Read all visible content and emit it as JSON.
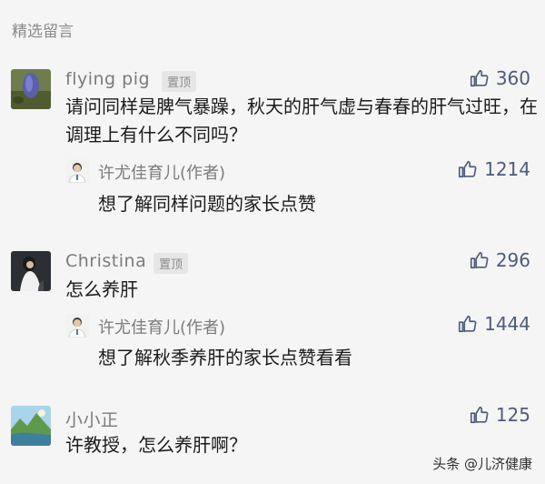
{
  "section_title": "精选留言",
  "comments": [
    {
      "username": "flying pig",
      "pinned_label": "置顶",
      "likes": "360",
      "text": "请问同样是脾气暴躁，秋天的肝气虚与春春的肝气过旺，在调理上有什么不同吗？",
      "reply": {
        "name": "许尤佳育儿(作者)",
        "likes": "1214",
        "text": "想了解同样问题的家长点赞"
      }
    },
    {
      "username": "Christina",
      "pinned_label": "置顶",
      "likes": "296",
      "text": "怎么养肝",
      "reply": {
        "name": "许尤佳育儿(作者)",
        "likes": "1444",
        "text": "想了解秋季养肝的家长点赞看看"
      }
    },
    {
      "username": "小小正",
      "likes": "125",
      "text": "许教授，怎么养肝啊？"
    }
  ],
  "watermark": "头条 @儿济健康",
  "colors": {
    "link_blue": "#4d5c7a",
    "muted_gray": "#7b7b7b",
    "background": "#f5f5f5"
  },
  "icons": [
    "thumbs-up-icon",
    "author-avatar",
    "user-avatar"
  ]
}
